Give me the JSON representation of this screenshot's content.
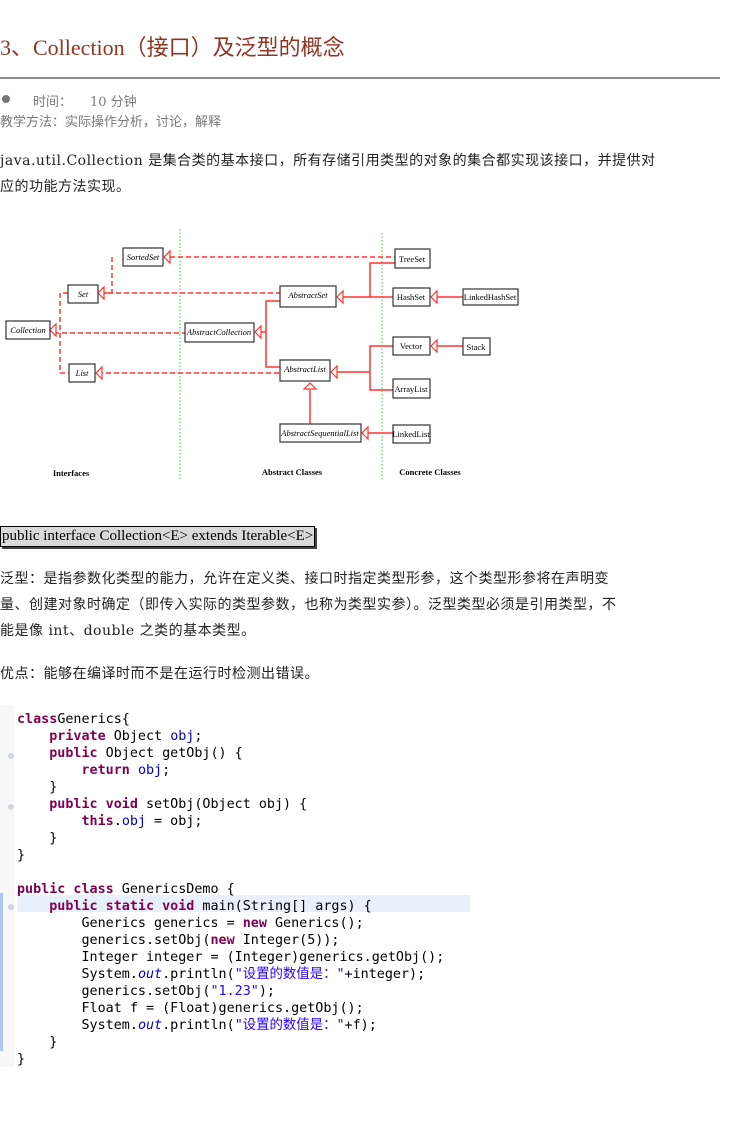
{
  "title": "3、Collection（接口）及泛型的概念",
  "meta": {
    "time_label": "时间：",
    "time_value": "10 分钟",
    "method": "教学方法：实际操作分析，讨论，解释"
  },
  "intro": [
    "java.util.Collection 是集合类的基本接口，所有存储引用类型的对象的集合都实现该接口，并提供对",
    "应的功能方法实现。"
  ],
  "diagram": {
    "columns": [
      "Interfaces",
      "Abstract Classes",
      "Concrete Classes"
    ],
    "interfaces": [
      "SortedSet",
      "Set",
      "Collection",
      "List"
    ],
    "abstract": [
      "AbstractCollection",
      "AbstractSet",
      "AbstractList",
      "AbstractSequentialList"
    ],
    "concrete": [
      "TreeSet",
      "HashSet",
      "LinkedHashSet",
      "Vector",
      "Stack",
      "ArrayList",
      "LinkedList"
    ],
    "line_color": "#ff3333",
    "divider_color": "#33cc33"
  },
  "interface_decl": "public interface Collection<E> extends Iterable<E>",
  "generics": [
    "泛型：是指参数化类型的能力，允许在定义类、接口时指定类型形参，这个类型形参将在声明变",
    "量、创建对象时确定（即传入实际的类型参数，也称为类型实参）。泛型类型必须是引用类型，不",
    "能是像 int、double 之类的基本类型。"
  ],
  "advantage": "优点：能够在编译时而不是在运行时检测出错误。",
  "code": [
    [
      [
        "kw",
        "class"
      ],
      [
        "",
        "Generics{"
      ]
    ],
    [
      [
        "",
        "    "
      ],
      [
        "kw",
        "private"
      ],
      [
        "",
        " Object "
      ],
      [
        "fld",
        "obj"
      ],
      [
        "",
        ";"
      ]
    ],
    [
      [
        "",
        "    "
      ],
      [
        "kw",
        "public"
      ],
      [
        "",
        " Object getObj() {"
      ]
    ],
    [
      [
        "",
        "        "
      ],
      [
        "kw",
        "return"
      ],
      [
        "",
        " "
      ],
      [
        "fld",
        "obj"
      ],
      [
        "",
        ";"
      ]
    ],
    [
      [
        "",
        "    }"
      ]
    ],
    [
      [
        "",
        "    "
      ],
      [
        "kw",
        "public void"
      ],
      [
        "",
        " setObj(Object obj) {"
      ]
    ],
    [
      [
        "",
        "        "
      ],
      [
        "kw",
        "this"
      ],
      [
        "",
        "."
      ],
      [
        "fld",
        "obj"
      ],
      [
        "",
        " = obj;"
      ]
    ],
    [
      [
        "",
        "    }"
      ]
    ],
    [
      [
        "",
        "}"
      ]
    ],
    [
      [
        "",
        ""
      ]
    ],
    [
      [
        "kw",
        "public class"
      ],
      [
        "",
        " GenericsDemo {"
      ]
    ],
    [
      [
        "",
        "    "
      ],
      [
        "kw",
        "public static void"
      ],
      [
        "",
        " main(String[] args) {"
      ]
    ],
    [
      [
        "",
        "        Generics generics = "
      ],
      [
        "kw",
        "new"
      ],
      [
        "",
        " Generics();"
      ]
    ],
    [
      [
        "",
        "        generics.setObj("
      ],
      [
        "kw",
        "new"
      ],
      [
        "",
        " Integer(5));"
      ]
    ],
    [
      [
        "",
        "        Integer integer = (Integer)generics.getObj();"
      ]
    ],
    [
      [
        "",
        "        System."
      ],
      [
        "it",
        "out"
      ],
      [
        "",
        ".println("
      ],
      [
        "st",
        "\"设置的数值是：\""
      ],
      [
        "",
        "+integer);"
      ]
    ],
    [
      [
        "",
        "        generics.setObj("
      ],
      [
        "st",
        "\"1.23\""
      ],
      [
        "",
        ");"
      ]
    ],
    [
      [
        "",
        "        Float f = (Float)generics.getObj();"
      ]
    ],
    [
      [
        "",
        "        System."
      ],
      [
        "it",
        "out"
      ],
      [
        "",
        ".println("
      ],
      [
        "st",
        "\"设置的数值是：\""
      ],
      [
        "",
        "+f);"
      ]
    ],
    [
      [
        "",
        "    }"
      ]
    ],
    [
      [
        "",
        "}"
      ]
    ]
  ]
}
